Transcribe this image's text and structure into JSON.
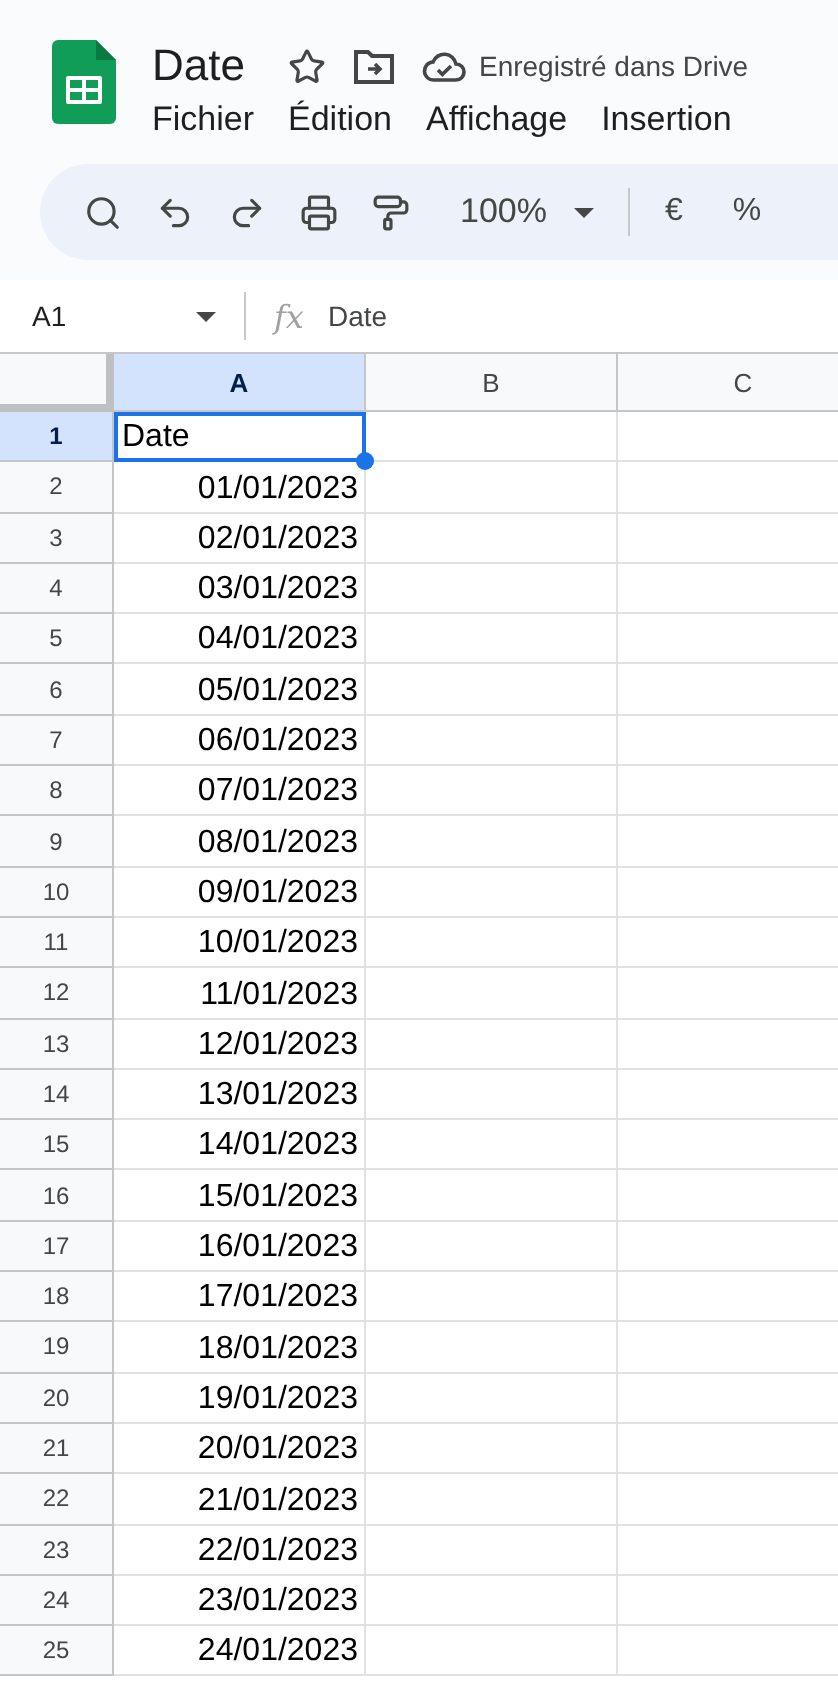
{
  "document": {
    "title": "Date",
    "starred": false,
    "save_status": "Enregistré dans Drive"
  },
  "menu": [
    "Fichier",
    "Édition",
    "Affichage",
    "Insertion"
  ],
  "toolbar": {
    "zoom": "100%",
    "currency": "€",
    "percent": "%"
  },
  "formula_bar": {
    "cell_ref": "A1",
    "fx": "fx",
    "value": "Date"
  },
  "sheet": {
    "columns": [
      {
        "label": "A",
        "selected": true
      },
      {
        "label": "B",
        "selected": false
      },
      {
        "label": "C",
        "selected": false
      }
    ],
    "rows": [
      {
        "number": "1",
        "selected": true,
        "kind": "text",
        "a": "Date"
      },
      {
        "number": "2",
        "selected": false,
        "kind": "date",
        "a": "01/01/2023"
      },
      {
        "number": "3",
        "selected": false,
        "kind": "date",
        "a": "02/01/2023"
      },
      {
        "number": "4",
        "selected": false,
        "kind": "date",
        "a": "03/01/2023"
      },
      {
        "number": "5",
        "selected": false,
        "kind": "date",
        "a": "04/01/2023"
      },
      {
        "number": "6",
        "selected": false,
        "kind": "date",
        "a": "05/01/2023"
      },
      {
        "number": "7",
        "selected": false,
        "kind": "date",
        "a": "06/01/2023"
      },
      {
        "number": "8",
        "selected": false,
        "kind": "date",
        "a": "07/01/2023"
      },
      {
        "number": "9",
        "selected": false,
        "kind": "date",
        "a": "08/01/2023"
      },
      {
        "number": "10",
        "selected": false,
        "kind": "date",
        "a": "09/01/2023"
      },
      {
        "number": "11",
        "selected": false,
        "kind": "date",
        "a": "10/01/2023"
      },
      {
        "number": "12",
        "selected": false,
        "kind": "date",
        "a": "11/01/2023"
      },
      {
        "number": "13",
        "selected": false,
        "kind": "date",
        "a": "12/01/2023"
      },
      {
        "number": "14",
        "selected": false,
        "kind": "date",
        "a": "13/01/2023"
      },
      {
        "number": "15",
        "selected": false,
        "kind": "date",
        "a": "14/01/2023"
      },
      {
        "number": "16",
        "selected": false,
        "kind": "date",
        "a": "15/01/2023"
      },
      {
        "number": "17",
        "selected": false,
        "kind": "date",
        "a": "16/01/2023"
      },
      {
        "number": "18",
        "selected": false,
        "kind": "date",
        "a": "17/01/2023"
      },
      {
        "number": "19",
        "selected": false,
        "kind": "date",
        "a": "18/01/2023"
      },
      {
        "number": "20",
        "selected": false,
        "kind": "date",
        "a": "19/01/2023"
      },
      {
        "number": "21",
        "selected": false,
        "kind": "date",
        "a": "20/01/2023"
      },
      {
        "number": "22",
        "selected": false,
        "kind": "date",
        "a": "21/01/2023"
      },
      {
        "number": "23",
        "selected": false,
        "kind": "date",
        "a": "22/01/2023"
      },
      {
        "number": "24",
        "selected": false,
        "kind": "date",
        "a": "23/01/2023"
      },
      {
        "number": "25",
        "selected": false,
        "kind": "date",
        "a": "24/01/2023"
      }
    ]
  }
}
